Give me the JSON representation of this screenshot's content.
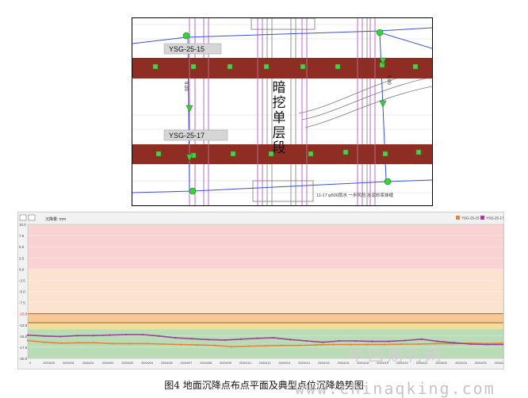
{
  "plan": {
    "labels": [
      "YSG-25-15",
      "YSG-25-17"
    ],
    "section_title": "暗挖单层段",
    "distances": [
      "9.00",
      "9.00"
    ],
    "pipe_note": "11-17  φ500雨水  一步风险   水泥砂浆抹缝"
  },
  "chart_data": {
    "type": "line",
    "title": "",
    "ylabel": "沉降量: mm",
    "xlabel": "",
    "legend_position": "top-right",
    "ylim": [
      -20,
      10
    ],
    "yticks": [
      10,
      7.5,
      5,
      2.5,
      0,
      -2.5,
      -5,
      -7.5,
      -10,
      -12.5,
      -15,
      -17.5,
      -20
    ],
    "ytick_labels": [
      "10.0",
      "7.5",
      "5.0",
      "2.5",
      "0.0",
      "-2.5",
      "-5.0",
      "-7.5",
      "-10.0",
      "-12.5",
      "-15.0",
      "-17.5",
      "-20.0"
    ],
    "bands": [
      {
        "from": 0,
        "to": 10,
        "color": "#f9d3d3"
      },
      {
        "from": -10,
        "to": 0,
        "color": "#fbe3cf"
      },
      {
        "from": -12.5,
        "to": -10,
        "color": "#f5c896"
      },
      {
        "from": -13.5,
        "to": -12.5,
        "color": "#eedf9a"
      },
      {
        "from": -20,
        "to": -13.5,
        "color": "#b9dbb5"
      }
    ],
    "threshold_lines": [
      {
        "value": -10,
        "color": "#cc3a26",
        "label": "-10.0"
      },
      {
        "value": -12,
        "color": "#8a6a25",
        "label": ""
      }
    ],
    "x_labels": [
      "0",
      "20/03/29",
      "20/03/31",
      "20/04/01",
      "20/04/02",
      "20/04/03",
      "20/04/04",
      "20/04/06",
      "20/04/07",
      "20/04/08",
      "20/04/09",
      "20/04/10",
      "20/04/12",
      "20/04/13",
      "20/04/14",
      "20/04/15",
      "20/04/16",
      "20/04/18",
      "20/04/19",
      "20/04/20",
      "20/04/21",
      "20/04/22",
      "20/04/24",
      "20/04/25",
      "20/04/26"
    ],
    "series": [
      {
        "name": "YSG-25-15",
        "color": "#e8833a",
        "values": [
          -16.0,
          -16.4,
          -16.6,
          -16.5,
          -16.5,
          -16.7,
          -16.7,
          -16.7,
          -16.8,
          -16.9,
          -17.0,
          -17.1,
          -17.4,
          -17.3,
          -17.2,
          -17.1,
          -17.1,
          -17.0,
          -16.9,
          -16.9,
          -16.9,
          -16.9,
          -16.8,
          -16.8,
          -16.7,
          -16.7,
          -16.6,
          -16.7,
          -16.6
        ]
      },
      {
        "name": "YSG-25-17",
        "color": "#9b4496",
        "values": [
          -14.8,
          -15.0,
          -15.1,
          -14.9,
          -14.9,
          -14.8,
          -14.7,
          -14.7,
          -15.0,
          -15.4,
          -15.6,
          -15.8,
          -15.9,
          -15.7,
          -15.5,
          -15.4,
          -15.8,
          -16.1,
          -16.4,
          -16.1,
          -16.1,
          -16.2,
          -16.2,
          -16.0,
          -15.7,
          -16.2,
          -16.5,
          -16.8,
          -16.9,
          -16.9
        ]
      }
    ]
  },
  "caption": "图4 地面沉降点布点平面及典型点位沉降趋势图",
  "watermark": {
    "url": "www.chinaqking.com",
    "cn": "中国期刊网"
  }
}
